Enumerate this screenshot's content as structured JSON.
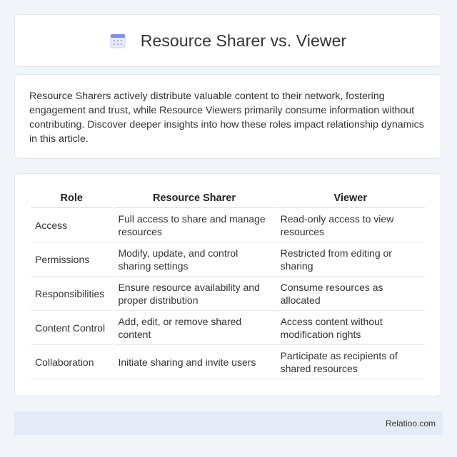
{
  "header": {
    "title": "Resource Sharer vs. Viewer",
    "icon": "calendar-icon"
  },
  "intro": {
    "text": "Resource Sharers actively distribute valuable content to their network, fostering engagement and trust, while Resource Viewers primarily consume information without contributing. Discover deeper insights into how these roles impact relationship dynamics in this article."
  },
  "table": {
    "headers": [
      "Role",
      "Resource Sharer",
      "Viewer"
    ],
    "rows": [
      [
        "Access",
        "Full access to share and manage resources",
        "Read-only access to view resources"
      ],
      [
        "Permissions",
        "Modify, update, and control sharing settings",
        "Restricted from editing or sharing"
      ],
      [
        "Responsibilities",
        "Ensure resource availability and proper distribution",
        "Consume resources as allocated"
      ],
      [
        "Content Control",
        "Add, edit, or remove shared content",
        "Access content without modification rights"
      ],
      [
        "Collaboration",
        "Initiate sharing and invite users",
        "Participate as recipients of shared resources"
      ]
    ]
  },
  "footer": {
    "brand": "Relatioo.com"
  },
  "colors": {
    "page_background": "#f1f4f9",
    "card_background": "#ffffff",
    "footer_background": "#e5ebf6",
    "icon_accent": "#7b8ff0"
  }
}
